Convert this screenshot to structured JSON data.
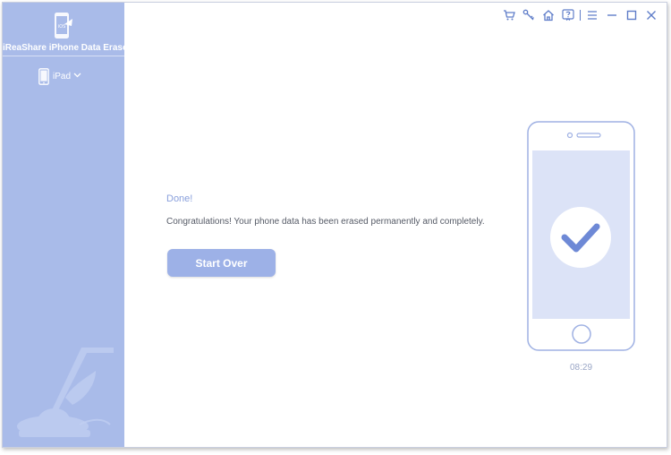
{
  "app": {
    "title": "iReaShare iPhone Data Eraser"
  },
  "sidebar": {
    "device": {
      "name": "iPad",
      "icon": "ipad-icon"
    }
  },
  "titlebar": {
    "icons": [
      "cart-icon",
      "key-icon",
      "home-icon",
      "help-icon",
      "menu-icon",
      "minimize-icon",
      "maximize-icon",
      "close-icon"
    ]
  },
  "main": {
    "status": "Done!",
    "message": "Congratulations! Your phone data has been erased permanently and completely.",
    "start_over_label": "Start Over"
  },
  "phone": {
    "time": "08:29"
  },
  "colors": {
    "sidebar_bg": "#a9bbe9",
    "accent": "#5f7dc9",
    "button_bg": "#9db1e7",
    "check": "#6e89d6"
  }
}
